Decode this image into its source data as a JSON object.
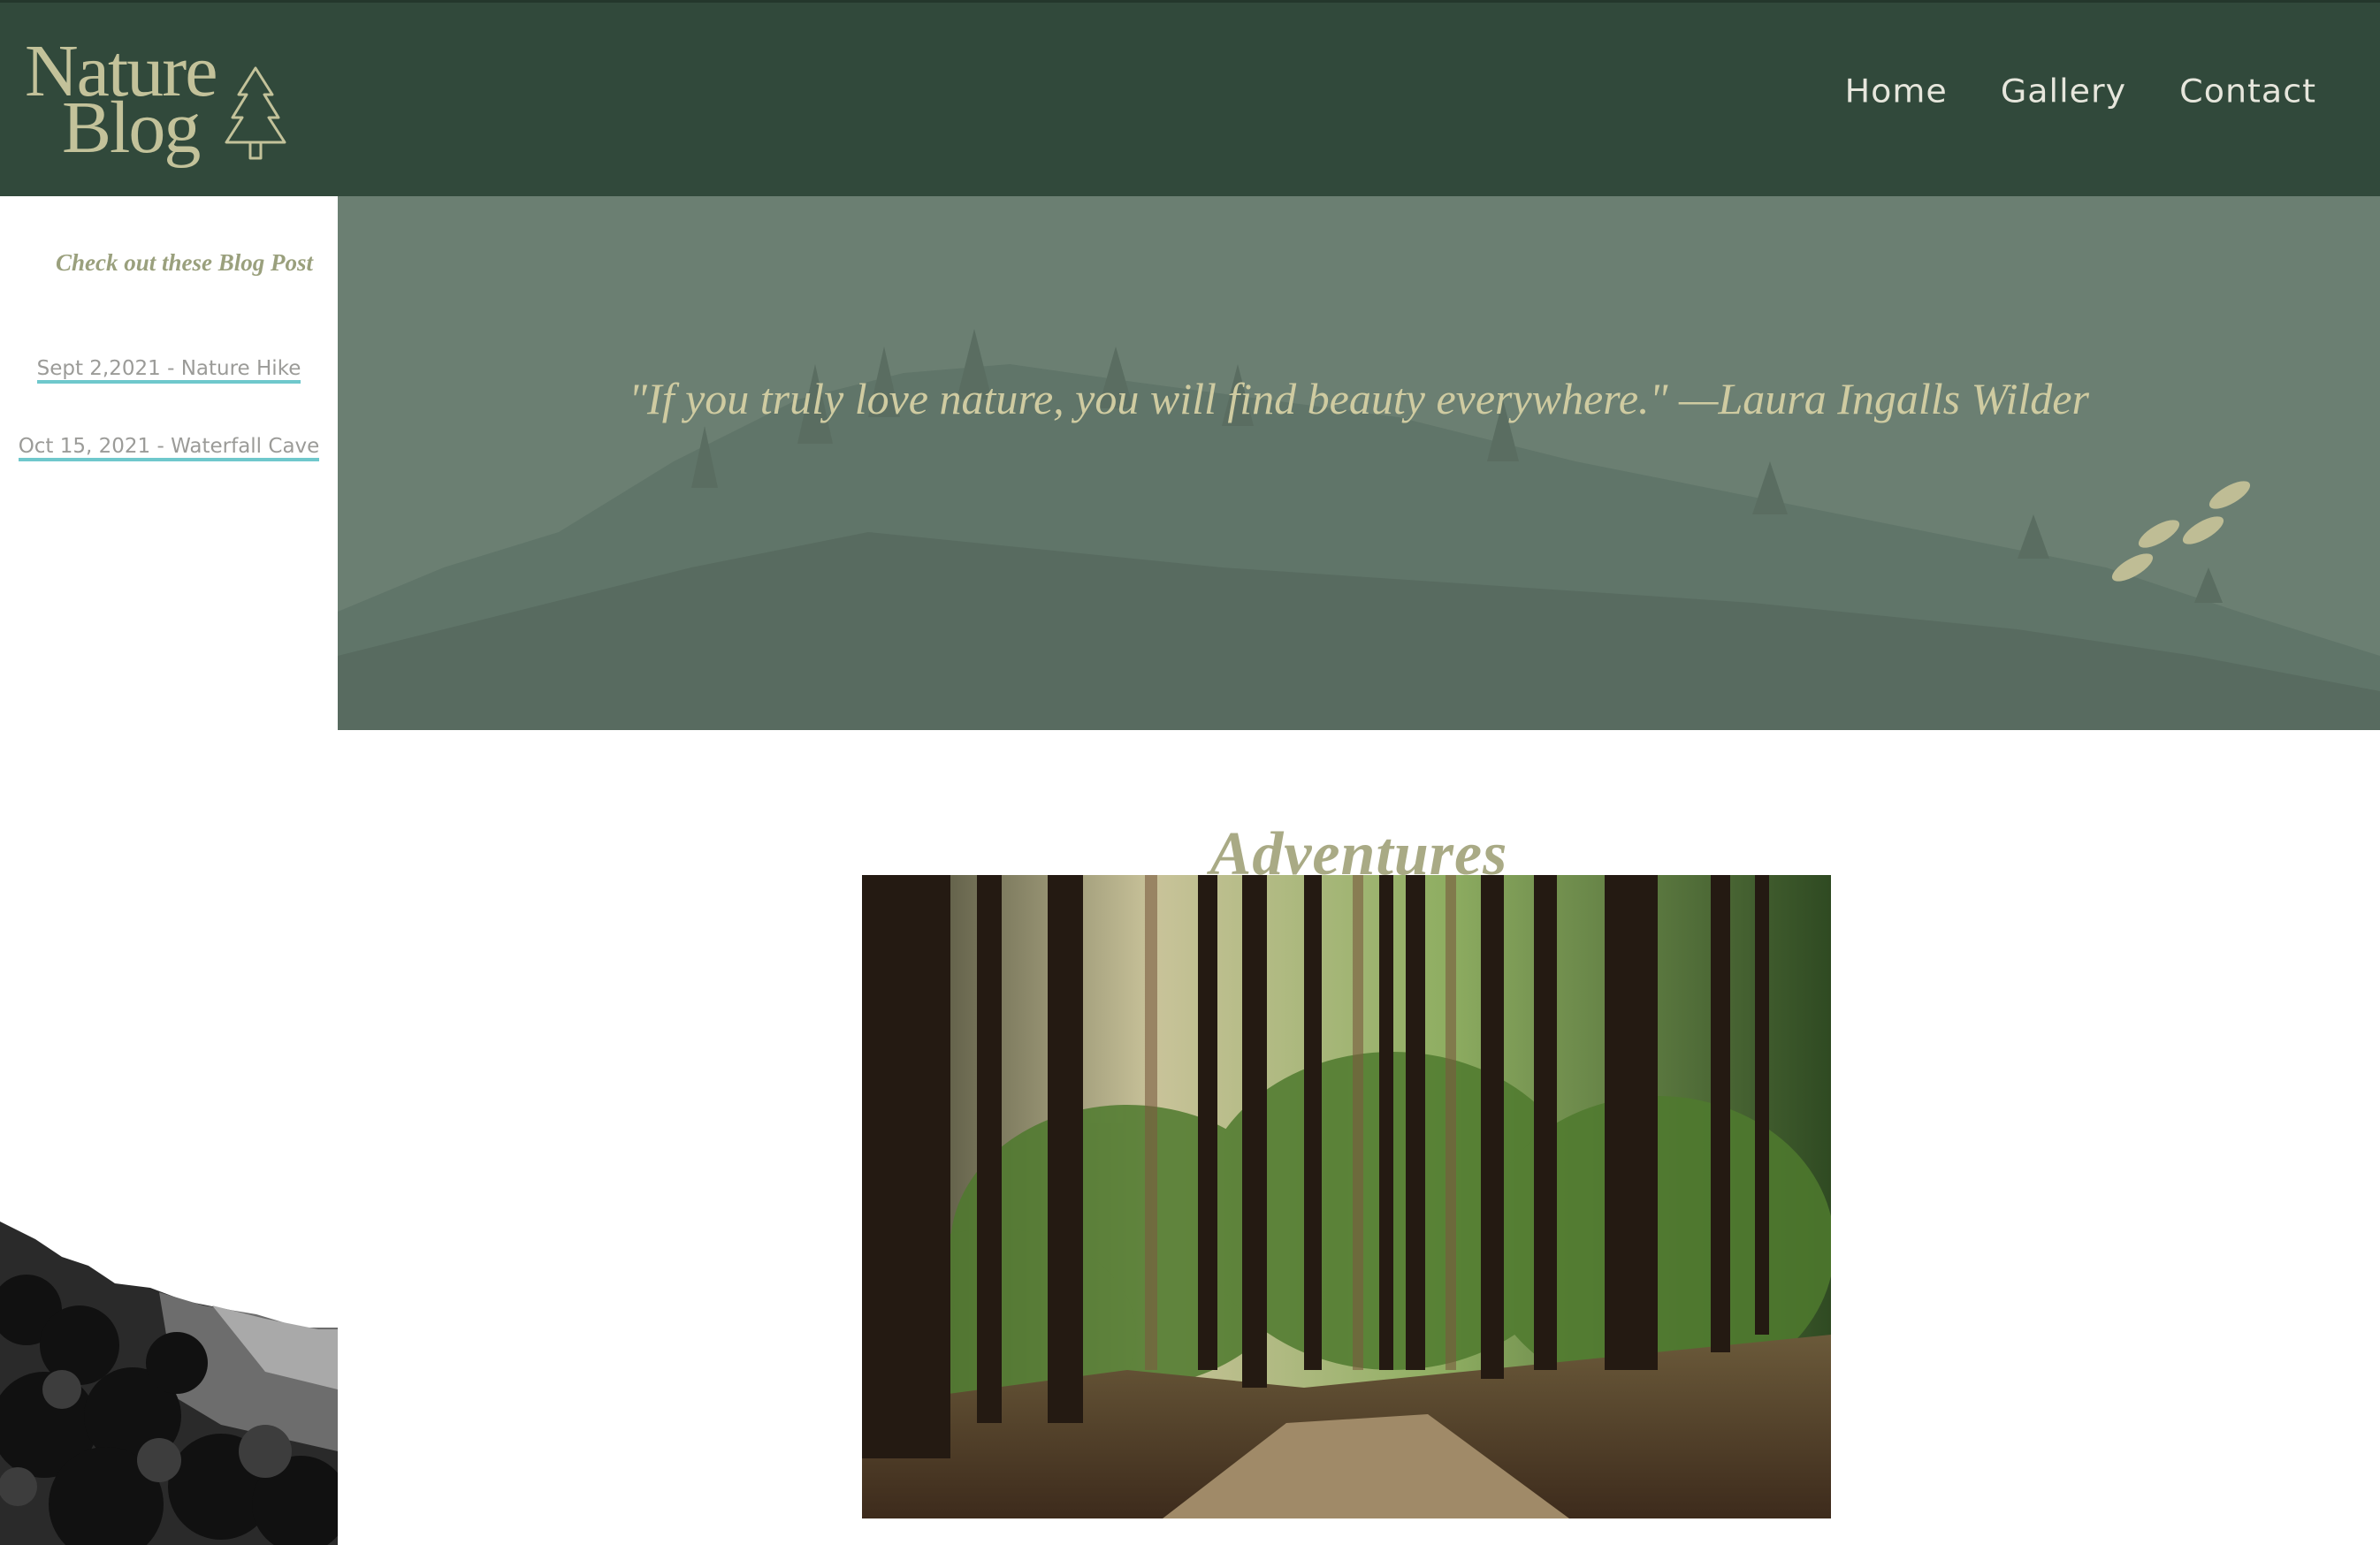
{
  "header": {
    "logo": {
      "line1": "Nature",
      "line2": "Blog",
      "icon": "pine-tree-icon"
    },
    "nav": [
      {
        "label": "Home"
      },
      {
        "label": "Gallery"
      },
      {
        "label": "Contact"
      }
    ]
  },
  "sidebar": {
    "title": "Check out these Blog Post",
    "links": [
      {
        "label": "Sept 2,2021 - Nature Hike"
      },
      {
        "label": "Oct 15, 2021 - Waterfall Cave"
      }
    ],
    "photo": "black-and-white-forest-hillside"
  },
  "hero": {
    "quote": "\"If you truly love nature, you will find beauty everywhere.\" —Laura Ingalls Wilder",
    "decoration": "footprints-icon"
  },
  "main": {
    "title": "Adventures",
    "photo": "forest-path-photo"
  },
  "colors": {
    "header_bg": "#31493b",
    "hero_bg": "#6b7f72",
    "accent": "#a9aa85",
    "link_underline": "#6fc8cc"
  }
}
